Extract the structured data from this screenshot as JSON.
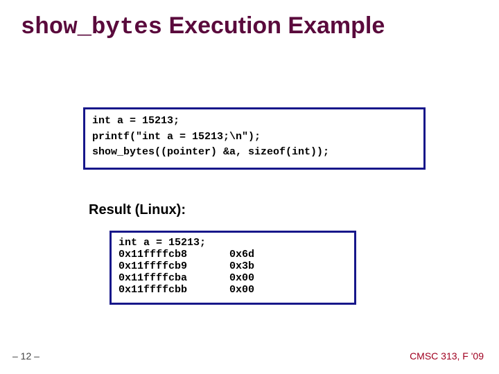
{
  "title": {
    "mono": "show_bytes",
    "rest": " Execution Example"
  },
  "code1": {
    "line1": "int a = 15213;",
    "line2": "printf(\"int a = 15213;\\n\");",
    "line3": "show_bytes((pointer) &a, sizeof(int));"
  },
  "result_label": "Result (Linux):",
  "code2": {
    "header": "int a = 15213;",
    "rows": [
      {
        "addr": "0x11ffffcb8",
        "val": "0x6d"
      },
      {
        "addr": "0x11ffffcb9",
        "val": "0x3b"
      },
      {
        "addr": "0x11ffffcba",
        "val": "0x00"
      },
      {
        "addr": "0x11ffffcbb",
        "val": "0x00"
      }
    ]
  },
  "page_num": "– 12 –",
  "footer_right": "CMSC 313, F '09"
}
